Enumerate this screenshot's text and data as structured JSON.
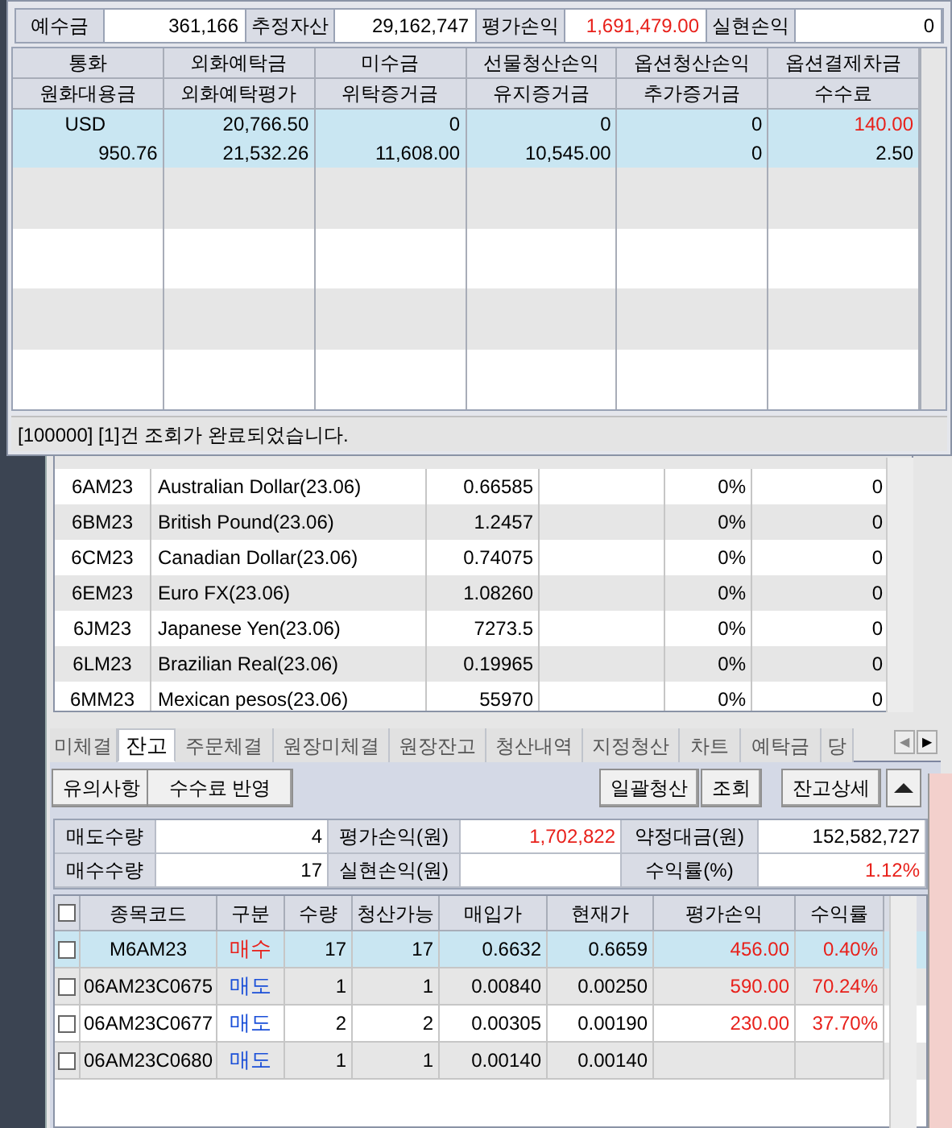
{
  "summary": [
    {
      "label": "예수금",
      "value": "361,166",
      "red": false
    },
    {
      "label": "추정자산",
      "value": "29,162,747",
      "red": false
    },
    {
      "label": "평가손익",
      "value": "1,691,479.00",
      "red": true
    },
    {
      "label": "실현손익",
      "value": "0",
      "red": false
    }
  ],
  "deposit_grid": {
    "header_rows": [
      [
        "통화",
        "외화예탁금",
        "미수금",
        "선물청산손익",
        "옵션청산손익",
        "옵션결제차금"
      ],
      [
        "원화대용금",
        "외화예탁평가",
        "위탁증거금",
        "유지증거금",
        "추가증거금",
        "수수료"
      ]
    ],
    "rows": [
      [
        {
          "text": "USD",
          "red": false
        },
        {
          "text": "20,766.50",
          "red": false
        },
        {
          "text": "0",
          "red": false
        },
        {
          "text": "0",
          "red": false
        },
        {
          "text": "0",
          "red": false
        },
        {
          "text": "140.00",
          "red": true
        }
      ],
      [
        {
          "text": "950.76",
          "red": false
        },
        {
          "text": "21,532.26",
          "red": false
        },
        {
          "text": "11,608.00",
          "red": false
        },
        {
          "text": "10,545.00",
          "red": false
        },
        {
          "text": "0",
          "red": false
        },
        {
          "text": "2.50",
          "red": false
        }
      ]
    ]
  },
  "status_bar": "[100000] [1]건 조회가 완료되었습니다.",
  "products": [
    {
      "code": "6AM23",
      "name": "Australian Dollar(23.06)",
      "price": "0.66585",
      "pct": "0%",
      "qty": "0"
    },
    {
      "code": "6BM23",
      "name": "British Pound(23.06)",
      "price": "1.2457",
      "pct": "0%",
      "qty": "0"
    },
    {
      "code": "6CM23",
      "name": "Canadian Dollar(23.06)",
      "price": "0.74075",
      "pct": "0%",
      "qty": "0"
    },
    {
      "code": "6EM23",
      "name": "Euro FX(23.06)",
      "price": "1.08260",
      "pct": "0%",
      "qty": "0"
    },
    {
      "code": "6JM23",
      "name": "Japanese Yen(23.06)",
      "price": "7273.5",
      "pct": "0%",
      "qty": "0"
    },
    {
      "code": "6LM23",
      "name": "Brazilian Real(23.06)",
      "price": "0.19965",
      "pct": "0%",
      "qty": "0"
    },
    {
      "code": "6MM23",
      "name": "Mexican pesos(23.06)",
      "price": "55970",
      "pct": "0%",
      "qty": "0"
    }
  ],
  "tabs": [
    {
      "label": "미체결",
      "selected": false
    },
    {
      "label": "잔고",
      "selected": true
    },
    {
      "label": "주문체결",
      "selected": false
    },
    {
      "label": "원장미체결",
      "selected": false
    },
    {
      "label": "원장잔고",
      "selected": false
    },
    {
      "label": "청산내역",
      "selected": false
    },
    {
      "label": "지정청산",
      "selected": false
    },
    {
      "label": "차트",
      "selected": false
    },
    {
      "label": "예탁금",
      "selected": false
    },
    {
      "label": "당",
      "selected": false
    }
  ],
  "tab_scroll": [
    "◀",
    "▶"
  ],
  "left_buttons": [
    "유의사항",
    "수수료 반영"
  ],
  "right_buttons": [
    "일괄청산",
    "조회",
    "잔고상세"
  ],
  "balance_summary": [
    [
      {
        "label": "매도수량",
        "value": "4",
        "red": false
      },
      {
        "label": "평가손익(원)",
        "value": "1,702,822",
        "red": true
      },
      {
        "label": "약정대금(원)",
        "value": "152,582,727",
        "red": false
      }
    ],
    [
      {
        "label": "매수수량",
        "value": "17",
        "red": false
      },
      {
        "label": "실현손익(원)"
      },
      {
        "label": "수익률(%)",
        "value": "1.12%",
        "red": true
      }
    ]
  ],
  "holdings": {
    "select_all_checked": false,
    "columns": [
      "종목코드",
      "구분",
      "수량",
      "청산가능",
      "매입가",
      "현재가",
      "평가손익",
      "수익률"
    ],
    "rows": [
      {
        "code": "M6AM23",
        "side": "매수",
        "kind": "buy",
        "qty": "17",
        "closable": "17",
        "buy_price": "0.6632",
        "current": "0.6659",
        "pl": "456.00",
        "rate": "0.40%",
        "selected": true,
        "checked": false
      },
      {
        "code": "06AM23C0675",
        "side": "매도",
        "kind": "sell",
        "qty": "1",
        "closable": "1",
        "buy_price": "0.00840",
        "current": "0.00250",
        "pl": "590.00",
        "rate": "70.24%",
        "selected": false,
        "checked": false
      },
      {
        "code": "06AM23C0677",
        "side": "매도",
        "kind": "sell",
        "qty": "2",
        "closable": "2",
        "buy_price": "0.00305",
        "current": "0.00190",
        "pl": "230.00",
        "rate": "37.70%",
        "selected": false,
        "checked": false
      },
      {
        "code": "06AM23C0680",
        "side": "매도",
        "kind": "sell",
        "qty": "1",
        "closable": "1",
        "buy_price": "0.00140",
        "current": "0.00140",
        "selected": false,
        "checked": false
      }
    ]
  }
}
